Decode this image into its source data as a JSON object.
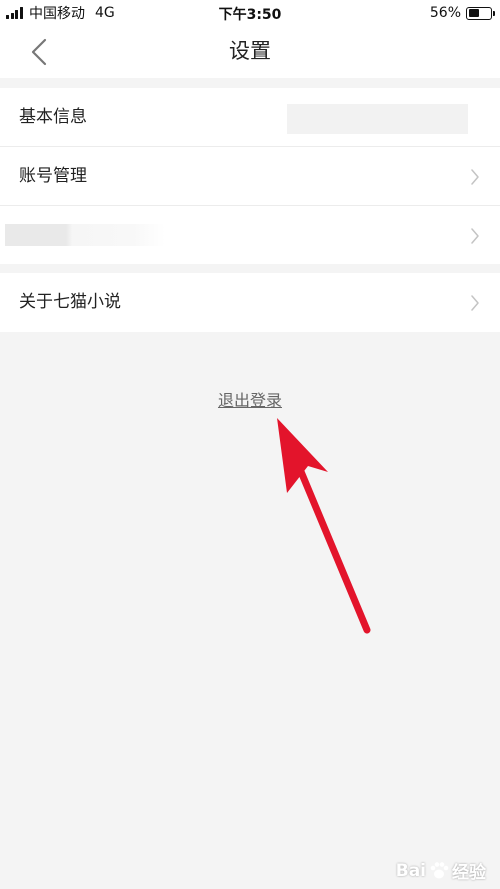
{
  "status_bar": {
    "carrier": "中国移动",
    "network": "4G",
    "time": "下午3:50",
    "battery_percent": "56%",
    "battery_level": 0.56
  },
  "nav": {
    "title": "设置",
    "back_icon": "chevron-left-icon"
  },
  "settings": {
    "items": [
      {
        "label": "基本信息"
      },
      {
        "label": "账号管理"
      },
      {
        "label": ""
      },
      {
        "label": "关于七猫小说"
      }
    ]
  },
  "logout": {
    "label": "退出登录"
  },
  "colors": {
    "annotation_arrow": "#e3142b",
    "background": "#f4f4f4"
  },
  "watermark": {
    "text_left": "Bai",
    "text_right": "经验"
  }
}
